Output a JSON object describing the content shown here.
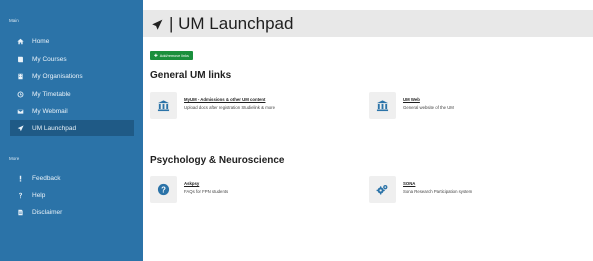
{
  "sidebar": {
    "section_main": "Main",
    "section_more": "More",
    "items": [
      {
        "label": "Home",
        "icon": "home-icon"
      },
      {
        "label": "My Courses",
        "icon": "book-icon"
      },
      {
        "label": "My Organisations",
        "icon": "building-icon"
      },
      {
        "label": "My Timetable",
        "icon": "clock-icon"
      },
      {
        "label": "My Webmail",
        "icon": "envelope-icon"
      },
      {
        "label": "UM Launchpad",
        "icon": "rocket-icon"
      }
    ],
    "more_items": [
      {
        "label": "Feedback",
        "icon": "exclamation-icon"
      },
      {
        "label": "Help",
        "icon": "question-icon"
      },
      {
        "label": "Disclaimer",
        "icon": "document-icon"
      }
    ]
  },
  "header": {
    "title": "| UM Launchpad"
  },
  "toolbar": {
    "add_remove_label": "Add/remove links"
  },
  "sections": [
    {
      "title": "General UM links",
      "cards": [
        {
          "title": "MyUM - Admissions & other UM content",
          "desc": "Upload docs after registration Studielink & more"
        },
        {
          "title": "UM Web",
          "desc": "General website of the UM"
        }
      ]
    },
    {
      "title": "Psychology & Neuroscience",
      "cards": [
        {
          "title": "Askpsy",
          "desc": "FAQs for FPN students"
        },
        {
          "title": "SONA",
          "desc": "Sona Research Participation system"
        }
      ]
    }
  ],
  "colors": {
    "sidebar": "#2b73a8",
    "sidebar_active": "#1f5a86",
    "header": "#e8e8e8",
    "add_button": "#1a8f3c",
    "card_icon": "#2b73a8"
  }
}
